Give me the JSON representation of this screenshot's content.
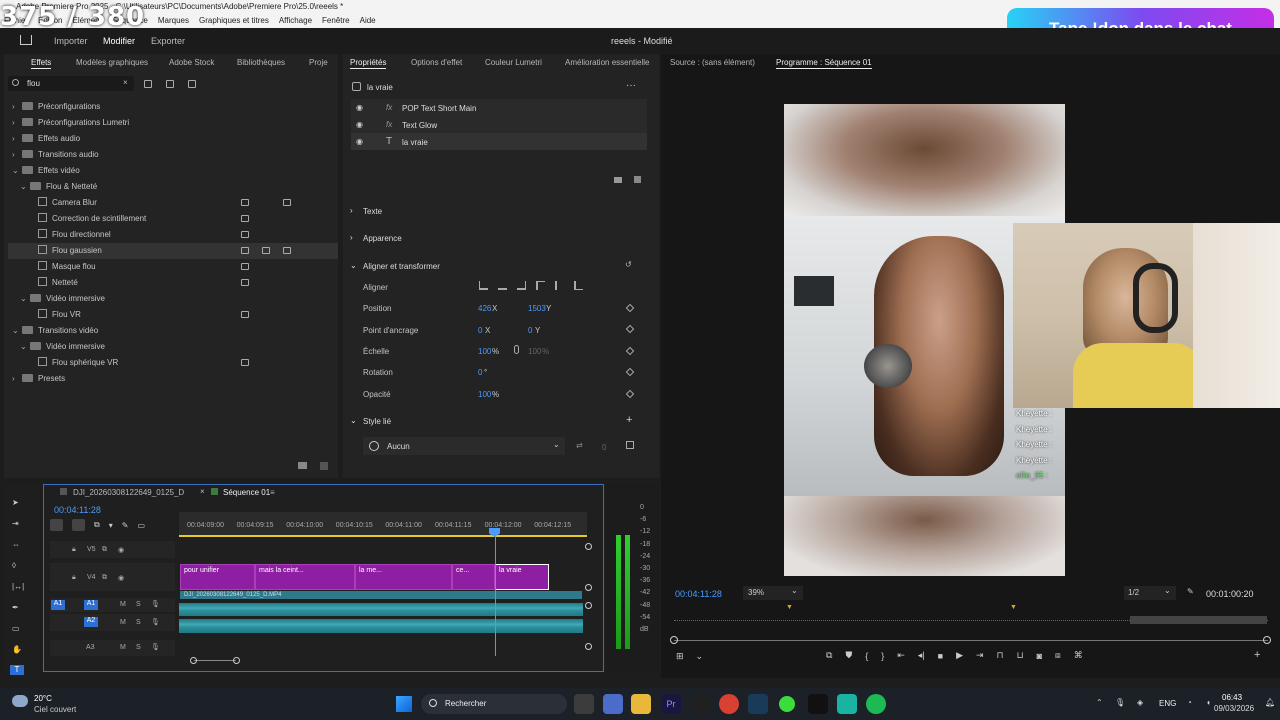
{
  "titlebar": {
    "text": "Adobe Premiere Pro 2025 - C:\\Utilisateurs\\PC\\Documents\\Adobe\\Premiere Pro\\25.0\\reeels *"
  },
  "menu": [
    "Fichier",
    "Édition",
    "Élément",
    "Séquence",
    "Marques",
    "Graphiques et titres",
    "Affichage",
    "Fenêtre",
    "Aide"
  ],
  "overlay": {
    "count": "375 / 380",
    "donate": "Tape !don dans le chat"
  },
  "workspace": {
    "tabs": [
      "Importer",
      "Modifier",
      "Exporter"
    ],
    "project": "reeels - Modifié"
  },
  "left_panel": {
    "tabs": [
      "Effets",
      "Modèles graphiques",
      "Adobe Stock",
      "Bibliothèques",
      "Proje"
    ],
    "search": "flou",
    "tree": [
      {
        "label": "Préconfigurations",
        "kind": "folder",
        "indent": 0
      },
      {
        "label": "Préconfigurations Lumetri",
        "kind": "folder",
        "indent": 0
      },
      {
        "label": "Effets audio",
        "kind": "folder",
        "indent": 0
      },
      {
        "label": "Transitions audio",
        "kind": "folder",
        "indent": 0
      },
      {
        "label": "Effets vidéo",
        "kind": "folder",
        "indent": 0,
        "open": true
      },
      {
        "label": "Flou & Netteté",
        "kind": "folder",
        "indent": 1,
        "open": true
      },
      {
        "label": "Camera Blur",
        "kind": "fx",
        "indent": 2
      },
      {
        "label": "Correction de scintillement",
        "kind": "fx",
        "indent": 2
      },
      {
        "label": "Flou directionnel",
        "kind": "fx",
        "indent": 2
      },
      {
        "label": "Flou gaussien",
        "kind": "fx",
        "indent": 2,
        "selected": true
      },
      {
        "label": "Masque flou",
        "kind": "fx",
        "indent": 2
      },
      {
        "label": "Netteté",
        "kind": "fx",
        "indent": 2
      },
      {
        "label": "Vidéo immersive",
        "kind": "folder",
        "indent": 1,
        "open": true
      },
      {
        "label": "Flou VR",
        "kind": "fx",
        "indent": 2
      },
      {
        "label": "Transitions vidéo",
        "kind": "folder",
        "indent": 0,
        "open": true
      },
      {
        "label": "Vidéo immersive",
        "kind": "folder",
        "indent": 1,
        "open": true
      },
      {
        "label": "Flou sphérique VR",
        "kind": "fx",
        "indent": 2
      },
      {
        "label": "Presets",
        "kind": "folder",
        "indent": 0
      }
    ]
  },
  "props": {
    "tabs": [
      "Propriétés",
      "Options d'effet",
      "Couleur Lumetri",
      "Amélioration essentielle"
    ],
    "clip": "la vraie",
    "layers": [
      "POP Text Short Main",
      "Text Glow",
      "la vraie"
    ],
    "sections": [
      "Texte",
      "Apparence",
      "Aligner et transformer"
    ],
    "align_label": "Aligner",
    "position": {
      "label": "Position",
      "x": "426",
      "y": "1503",
      "xu": "X",
      "yu": "Y"
    },
    "anchor": {
      "label": "Point d'ancrage",
      "x": "0",
      "y": "0",
      "xu": "X",
      "yu": "Y"
    },
    "scale": {
      "label": "Échelle",
      "v": "100",
      "v2": "100",
      "unit": "%"
    },
    "rotation": {
      "label": "Rotation",
      "v": "0",
      "unit": "°"
    },
    "opacity": {
      "label": "Opacité",
      "v": "100",
      "unit": "%"
    },
    "style": {
      "label": "Style lié",
      "value": "Aucun",
      "count": "0"
    }
  },
  "program": {
    "source_tab": "Source : (sans élément)",
    "program_tab": "Programme : Séquence 01",
    "timecode": "00:04:11:28",
    "zoom": "39%",
    "res": "1/2",
    "duration": "00:01:00:20"
  },
  "chat": [
    "Kheyette :",
    "Kheyette :",
    "Kheyette :",
    "Kheyette :",
    "ellie_95 :"
  ],
  "timeline": {
    "tabs": [
      "DJI_20260308122649_0125_D",
      "Séquence 01"
    ],
    "timecode": "00:04:11:28",
    "ruler": [
      "00:04:09:00",
      "00:04:09:15",
      "00:04:10:00",
      "00:04:10:15",
      "00:04:11:00",
      "00:04:11:15",
      "00:04:12:00",
      "00:04:12:15"
    ],
    "tracks": [
      "V5",
      "V4",
      "A1",
      "A2",
      "A3"
    ],
    "clips": [
      "pour unifier",
      "mais la ceint...",
      "la me...",
      "ce...",
      "la vraie"
    ],
    "video_clip": "DJI_20260308122649_0125_D.MP4",
    "meter": [
      "0",
      "-6",
      "-12",
      "-18",
      "-24",
      "-30",
      "-36",
      "-42",
      "-48",
      "-54",
      "dB"
    ]
  },
  "taskbar": {
    "temp": "20°C",
    "weather": "Ciel couvert",
    "search": "Rechercher",
    "lang": "ENG",
    "time": "06:43",
    "date": "09/03/2026"
  }
}
